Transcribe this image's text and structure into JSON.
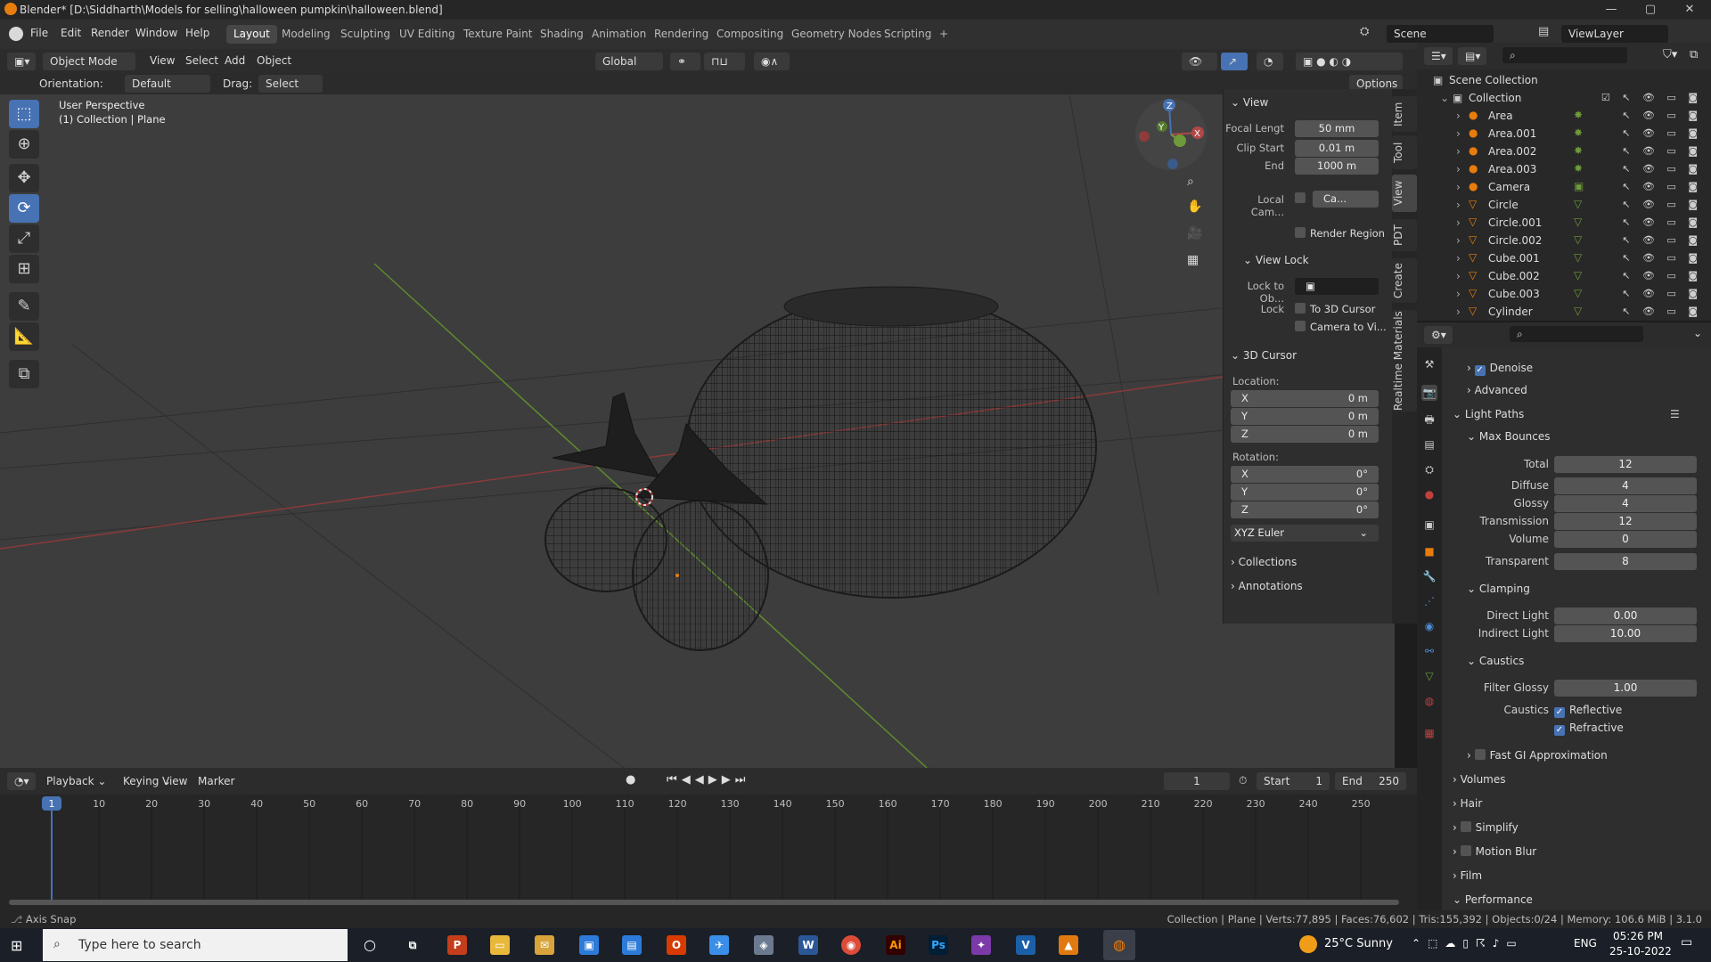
{
  "window": {
    "title": "Blender* [D:\\Siddharth\\Models for selling\\halloween pumpkin\\halloween.blend]",
    "minimize": "—",
    "maximize": "▢",
    "close": "✕"
  },
  "menubar": {
    "items": [
      "File",
      "Edit",
      "Render",
      "Window",
      "Help"
    ],
    "workspaces": [
      "Layout",
      "Modeling",
      "Sculpting",
      "UV Editing",
      "Texture Paint",
      "Shading",
      "Animation",
      "Rendering",
      "Compositing",
      "Geometry Nodes",
      "Scripting",
      "+"
    ],
    "active_workspace": "Layout",
    "scene": "Scene",
    "view_layer": "ViewLayer"
  },
  "viewport_header": {
    "mode": "Object Mode",
    "menus": [
      "View",
      "Select",
      "Add",
      "Object"
    ],
    "transform": "Global",
    "orientation_label": "Orientation:",
    "orientation_value": "Default",
    "drag_label": "Drag:",
    "drag_value": "Select Box",
    "options": "Options"
  },
  "viewport": {
    "perspective": "User Perspective",
    "collection": "(1) Collection | Plane",
    "gizmo": {
      "x": "X",
      "y": "Y",
      "z": "Z"
    }
  },
  "npanel": {
    "view_header": "View",
    "focal_label": "Focal Lengt",
    "focal_value": "50 mm",
    "clip_start_label": "Clip Start",
    "clip_start_value": "0.01 m",
    "end_label": "End",
    "end_value": "1000 m",
    "local_cam_label": "Local Cam...",
    "local_cam_value": "Ca...",
    "render_region": "Render Region",
    "view_lock_header": "View Lock",
    "lock_to_obj_label": "Lock to Ob...",
    "lock_label": "Lock",
    "to_3d_cursor": "To 3D Cursor",
    "camera_to_view": "Camera to Vi...",
    "cursor_header": "3D Cursor",
    "location_label": "Location:",
    "rotation_label": "Rotation:",
    "location": [
      {
        "axis": "X",
        "value": "0 m"
      },
      {
        "axis": "Y",
        "value": "0 m"
      },
      {
        "axis": "Z",
        "value": "0 m"
      }
    ],
    "rotation": [
      {
        "axis": "X",
        "value": "0°"
      },
      {
        "axis": "Y",
        "value": "0°"
      },
      {
        "axis": "Z",
        "value": "0°"
      }
    ],
    "rotation_mode": "XYZ Euler",
    "collections": "Collections",
    "annotations": "Annotations",
    "tabs": [
      "Item",
      "Tool",
      "View",
      "PDT",
      "Create",
      "Realtime Materials"
    ]
  },
  "timeline": {
    "menus": [
      "Playback",
      "Keying",
      "View",
      "Marker"
    ],
    "current_frame": "1",
    "start_label": "Start",
    "start_value": "1",
    "end_label": "End",
    "end_value": "250",
    "ticks": [
      "1",
      "10",
      "20",
      "30",
      "40",
      "50",
      "60",
      "70",
      "80",
      "90",
      "100",
      "110",
      "120",
      "130",
      "140",
      "150",
      "160",
      "170",
      "180",
      "190",
      "200",
      "210",
      "220",
      "230",
      "240",
      "250"
    ]
  },
  "statusbar": {
    "left": "Axis Snap",
    "right": "Collection | Plane | Verts:77,895 | Faces:76,602 | Tris:155,392 | Objects:0/24 | Memory: 106.6 MiB | 3.1.0"
  },
  "outliner": {
    "scene_collection": "Scene Collection",
    "collection": "Collection",
    "items": [
      "Area",
      "Area.001",
      "Area.002",
      "Area.003",
      "Camera",
      "Circle",
      "Circle.001",
      "Circle.002",
      "Cube.001",
      "Cube.002",
      "Cube.003",
      "Cylinder"
    ]
  },
  "properties": {
    "denoise": "Denoise",
    "advanced": "Advanced",
    "light_paths": "Light Paths",
    "max_bounces": "Max Bounces",
    "bounces": [
      {
        "label": "Total",
        "value": "12"
      },
      {
        "label": "Diffuse",
        "value": "4"
      },
      {
        "label": "Glossy",
        "value": "4"
      },
      {
        "label": "Transmission",
        "value": "12"
      },
      {
        "label": "Volume",
        "value": "0"
      }
    ],
    "transparent_label": "Transparent",
    "transparent_value": "8",
    "clamping": "Clamping",
    "direct_light_label": "Direct Light",
    "direct_light_value": "0.00",
    "indirect_light_label": "Indirect Light",
    "indirect_light_value": "10.00",
    "caustics_header": "Caustics",
    "filter_glossy_label": "Filter Glossy",
    "filter_glossy_value": "1.00",
    "caustics_label": "Caustics",
    "reflective": "Reflective",
    "refractive": "Refractive",
    "fast_gi": "Fast GI Approximation",
    "volumes": "Volumes",
    "hair": "Hair",
    "simplify": "Simplify",
    "motion_blur": "Motion Blur",
    "film": "Film",
    "performance": "Performance"
  },
  "taskbar": {
    "search_placeholder": "Type here to search",
    "weather": "25°C  Sunny",
    "lang": "ENG",
    "time": "05:26 PM",
    "date": "25-10-2022"
  },
  "colors": {
    "accent": "#4772b3",
    "blender_orange": "#e87d0d",
    "x_axis": "#b04848",
    "y_axis": "#6e9a3a"
  }
}
